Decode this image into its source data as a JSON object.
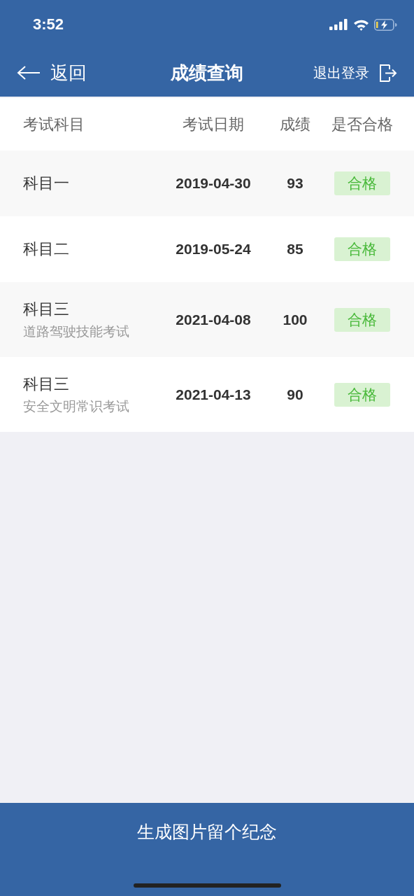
{
  "status_bar": {
    "time": "3:52"
  },
  "nav_bar": {
    "back_label": "返回",
    "title": "成绩查询",
    "logout_label": "退出登录"
  },
  "table": {
    "columns": [
      "考试科目",
      "考试日期",
      "成绩",
      "是否合格"
    ],
    "rows": [
      {
        "subject": "科目一",
        "date": "2019-04-30",
        "score": "93",
        "result": "合格",
        "passed": true
      },
      {
        "subject": "科目二",
        "date": "2019-05-24",
        "score": "85",
        "result": "合格",
        "passed": true
      },
      {
        "subject": "科目三",
        "subtitle": "道路驾驶技能考试",
        "date": "2021-04-08",
        "score": "100",
        "result": "合格",
        "passed": true
      },
      {
        "subject": "科目三",
        "subtitle": "安全文明常识考试",
        "date": "2021-04-13",
        "score": "90",
        "result": "合格",
        "passed": true
      }
    ]
  },
  "bottom_button": {
    "label": "生成图片留个纪念"
  }
}
